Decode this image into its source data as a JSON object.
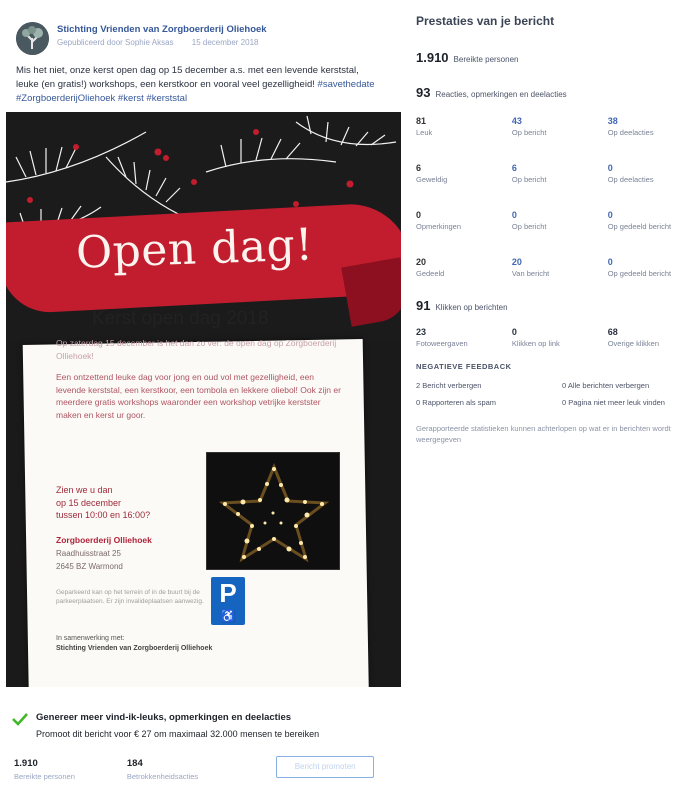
{
  "post": {
    "page_name": "Stichting Vrienden van Zorgboerderij Oliehoek",
    "meta_author": "Gepubliceerd door Sophie Aksas",
    "meta_date": "15 december 2018",
    "text_main": "Mis het niet, onze kerst open dag op 15 december a.s. met een levende kerststal, leuke (en gratis!) workshops, een kerstkoor en vooral veel gezelligheid!",
    "text_tags": "#savethedate #ZorgboerderijOliehoek #kerst #kerststal"
  },
  "poster": {
    "ribbon_title": "Open dag!",
    "heading": "Kerst open dag 2018",
    "intro": "Op zaterdag 15 december is het dan zo ver: de open dag op Zorgboerderij Olliehoek!",
    "body": "Een ontzettend leuke dag voor jong en oud vol met gezelligheid, een levende kerststal, een kerstkoor, een tombola en lekkere oliebol! Ook zijn er meerdere gratis workshops waaronder een workshop vetrijke kerstster maken en kerst ur goor.",
    "when_line1": "Zien we u dan",
    "when_line2": "op 15 december",
    "when_line3": "tussen 10:00 en 16:00?",
    "where_name": "Zorgboerderij Olliehoek",
    "where_street": "Raadhuisstraat 25",
    "where_city": "2645 BZ Warmond",
    "parking_text": "Geparkeerd kan op het terrein of in de buurt bij de parkeerplaatsen. Er zijn invalideplaatsen aanwezig.",
    "parking_icon_letter": "P",
    "parking_icon_symbol": "♿",
    "collab_label": "In samenwerking met:",
    "collab_org": "Stichting Vrienden van Zorgboerderij Olliehoek"
  },
  "promo": {
    "title": "Genereer meer vind-ik-leuks, opmerkingen en deelacties",
    "subtitle": "Promoot dit bericht voor € 27 om maximaal 32.000 mensen te bereiken"
  },
  "footer_stats": [
    {
      "num": "1.910",
      "label": "Bereikte personen"
    },
    {
      "num": "184",
      "label": "Betrokkenheidsacties"
    }
  ],
  "boost_button_label": "Bericht promoten",
  "insights": {
    "title": "Prestaties van je bericht",
    "reach_num": "1.910",
    "reach_label": "Bereikte personen",
    "reactions_num": "93",
    "reactions_label": "Reacties, opmerkingen en deelacties",
    "grid": [
      [
        {
          "v": "81",
          "l": "Leuk"
        },
        {
          "v": "43",
          "l": "Op bericht"
        },
        {
          "v": "38",
          "l": "Op deelacties"
        }
      ],
      [
        {
          "v": "6",
          "l": "Geweldig"
        },
        {
          "v": "6",
          "l": "Op bericht"
        },
        {
          "v": "0",
          "l": "Op deelacties"
        }
      ],
      [
        {
          "v": "0",
          "l": "Opmerkingen"
        },
        {
          "v": "0",
          "l": "Op bericht"
        },
        {
          "v": "0",
          "l": "Op gedeeld bericht"
        }
      ],
      [
        {
          "v": "20",
          "l": "Gedeeld"
        },
        {
          "v": "20",
          "l": "Van bericht"
        },
        {
          "v": "0",
          "l": "Op gedeeld bericht"
        }
      ]
    ],
    "clicks_num": "91",
    "clicks_label": "Klikken op berichten",
    "clicks_grid": [
      {
        "v": "23",
        "l": "Fotoweergaven"
      },
      {
        "v": "0",
        "l": "Klikken op link"
      },
      {
        "v": "68",
        "l": "Overige klikken"
      }
    ],
    "neg_title": "NEGATIEVE FEEDBACK",
    "neg_items": [
      "2 Bericht verbergen",
      "0 Alle berichten verbergen",
      "0 Rapporteren als spam",
      "0 Pagina niet meer leuk vinden"
    ],
    "footnote": "Gerapporteerde statistieken kunnen achterlopen op wat er in berichten wordt weergegeven"
  },
  "colors": {
    "link": "#365899",
    "ribbon": "#c21d2f",
    "check": "#42b72a"
  }
}
